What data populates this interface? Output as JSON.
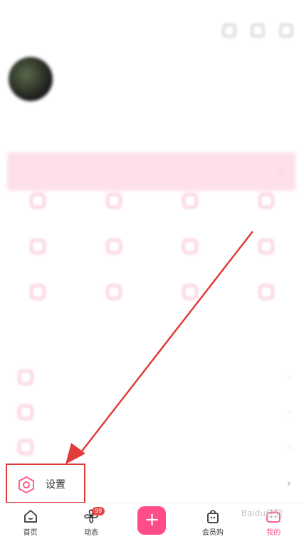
{
  "settings": {
    "label": "设置"
  },
  "tabbar": {
    "tabs": [
      {
        "label": "首页",
        "icon": "home-icon"
      },
      {
        "label": "动态",
        "icon": "pinwheel-icon",
        "badge": "99"
      },
      {
        "label": "+",
        "icon": "plus-icon"
      },
      {
        "label": "会员购",
        "icon": "shopping-bag-icon"
      },
      {
        "label": "我的",
        "icon": "tv-icon"
      }
    ]
  },
  "watermark": "Baidu经验",
  "colors": {
    "accent": "#ff4d88",
    "annotation": "#e23b3b",
    "badge": "#e54848"
  }
}
